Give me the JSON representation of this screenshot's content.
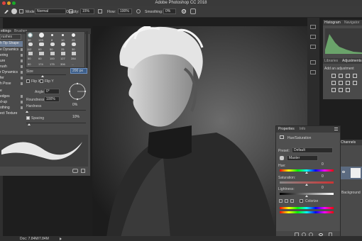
{
  "window": {
    "title": "Adobe Photoshop CC 2018"
  },
  "options_bar": {
    "mode_label": "Mode:",
    "mode_value": "Normal",
    "opacity_label": "Opacity:",
    "opacity_value": "15%",
    "flow_label": "Flow:",
    "flow_value": "100%",
    "smoothing_label": "Smoothing:",
    "smoothing_value": "0%"
  },
  "brush_panel": {
    "tabs": [
      "ettings",
      "Brushes"
    ],
    "brushes_button": "rushes",
    "sections": [
      "h Tip Shape",
      "e Dynamics",
      "ering",
      "ure",
      "rush",
      "r Dynamics",
      "fer",
      "h Pose",
      "e",
      "edges",
      "d-up",
      "othing",
      "ect Texture"
    ],
    "tip_sizes": [
      "30",
      "123",
      "8",
      "10",
      "25",
      "112",
      "60",
      "50",
      "25",
      "30",
      "50",
      "60",
      "100",
      "127",
      "284",
      "80",
      "174",
      "175",
      "306",
      "..."
    ],
    "size_label": "Size",
    "size_value": "200 px",
    "flip_x": "Flip X",
    "flip_y": "Flip Y",
    "angle_label": "Angle:",
    "angle_value": "0°",
    "roundness_label": "Roundness:",
    "roundness_value": "100%",
    "hardness_label": "Hardness",
    "hardness_value": "0%",
    "spacing_label": "Spacing",
    "spacing_value": "10%"
  },
  "status": {
    "doc_info": "Doc: 7.84M/7.84M"
  },
  "right_panels": {
    "histogram_tab": "Histogram",
    "navigator_tab": "Navigator",
    "libraries_tab": "Libraries",
    "adjustments_tab": "Adjustments",
    "add_adjustment": "Add an adjustment",
    "channels_tab": "Channels",
    "layer_name": "Background"
  },
  "properties": {
    "tab_properties": "Properties",
    "tab_info": "Info",
    "header": "Hue/Saturation",
    "preset_label": "Preset:",
    "preset_value": "Default",
    "channel_value": "Master",
    "hue_label": "Hue:",
    "hue_value": "0",
    "saturation_label": "Saturation:",
    "saturation_value": "0",
    "lightness_label": "Lightness:",
    "lightness_value": "0",
    "colorize_label": "Colorize"
  },
  "colors": {
    "accent": "#6b7c95",
    "panel": "#4a4a4a",
    "canvas_bg": "#2b2b2b"
  }
}
